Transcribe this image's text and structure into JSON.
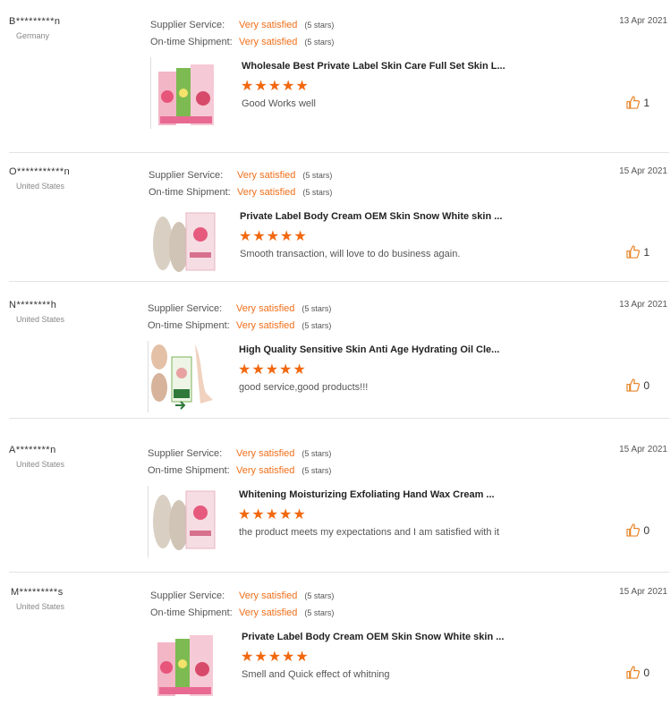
{
  "reviews": [
    {
      "buyer": "B*********n",
      "country": "Germany",
      "supplier_service_label": "Supplier Service:",
      "supplier_service_value": "Very satisfied",
      "supplier_service_stars": "(5 stars)",
      "shipment_label": "On-time Shipment:",
      "shipment_value": "Very satisfied",
      "shipment_stars": "(5 stars)",
      "date": "13 Apr 2021",
      "product_title": "Wholesale Best Private Label Skin Care Full Set Skin L...",
      "rating": 5,
      "stars": "★★★★★",
      "comment": "Good Works well",
      "helpful_count": "1",
      "thumbnail": "foot-mask-packs-pink-green"
    },
    {
      "buyer": "O***********n",
      "country": "United States",
      "supplier_service_label": "Supplier Service:",
      "supplier_service_value": "Very satisfied",
      "supplier_service_stars": "(5 stars)",
      "shipment_label": "On-time Shipment:",
      "shipment_value": "Very satisfied",
      "shipment_stars": "(5 stars)",
      "date": "15 Apr 2021",
      "product_title": "Private Label Body Cream OEM Skin Snow White skin ...",
      "rating": 5,
      "stars": "★★★★★",
      "comment": "Smooth transaction, will love to do business again.",
      "helpful_count": "1",
      "thumbnail": "foot-peel-with-pack"
    },
    {
      "buyer": "N********h",
      "country": "United States",
      "supplier_service_label": "Supplier Service:",
      "supplier_service_value": "Very satisfied",
      "supplier_service_stars": "(5 stars)",
      "shipment_label": "On-time Shipment:",
      "shipment_value": "Very satisfied",
      "shipment_stars": "(5 stars)",
      "date": "13 Apr 2021",
      "product_title": "High Quality Sensitive Skin Anti Age Hydrating Oil Cle...",
      "rating": 5,
      "stars": "★★★★★",
      "comment": "good service,good products!!!",
      "helpful_count": "0",
      "thumbnail": "feet-before-after"
    },
    {
      "buyer": "A********n",
      "country": "United States",
      "supplier_service_label": "Supplier Service:",
      "supplier_service_value": "Very satisfied",
      "supplier_service_stars": "(5 stars)",
      "shipment_label": "On-time Shipment:",
      "shipment_value": "Very satisfied",
      "shipment_stars": "(5 stars)",
      "date": "15 Apr 2021",
      "product_title": "Whitening Moisturizing Exfoliating Hand Wax Cream ...",
      "rating": 5,
      "stars": "★★★★★",
      "comment": "the product meets my expectations and I am satisfied with it",
      "helpful_count": "0",
      "thumbnail": "foot-peel-with-pack"
    },
    {
      "buyer": "M*********s",
      "country": "United States",
      "supplier_service_label": "Supplier Service:",
      "supplier_service_value": "Very satisfied",
      "supplier_service_stars": "(5 stars)",
      "shipment_label": "On-time Shipment:",
      "shipment_value": "Very satisfied",
      "shipment_stars": "(5 stars)",
      "date": "15 Apr 2021",
      "product_title": "Private Label Body Cream OEM Skin Snow White skin ...",
      "rating": 5,
      "stars": "★★★★★",
      "comment": "Smell and  Quick effect of whitning",
      "helpful_count": "0",
      "thumbnail": "foot-mask-packs-pink-green"
    }
  ],
  "colors": {
    "accent": "#f06f1a",
    "star": "#f2680f",
    "divider": "#e3e3e3"
  }
}
